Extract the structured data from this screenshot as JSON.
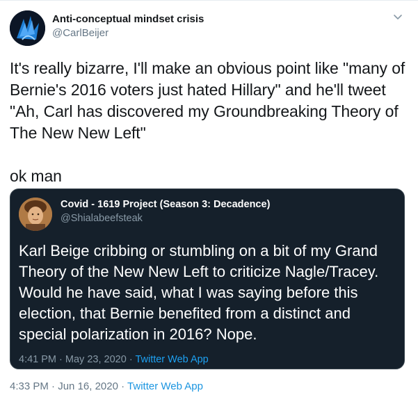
{
  "author": {
    "display_name": "Anti-conceptual mindset crisis",
    "handle": "@CarlBeijer"
  },
  "tweet": {
    "text": "It's really bizarre, I'll make an obvious point like \"many of Bernie's 2016 voters just hated Hillary\" and he'll tweet \"Ah, Carl has discovered my Groundbreaking Theory of The New New Left\"\n\nok man",
    "time": "4:33 PM",
    "separator": "·",
    "date": "Jun 16, 2020",
    "source": "Twitter Web App"
  },
  "quoted_tweet": {
    "display_name": "Covid - 1619 Project (Season 3: Decadence)",
    "handle": "@Shialabeefsteak",
    "text": "Karl Beige cribbing or stumbling on a bit of my Grand Theory of the New New Left to criticize Nagle/Tracey. Would he have said, what I was saying before this election, that Bernie benefited from a distinct and special polarization in 2016? Nope.",
    "time": "4:41 PM",
    "separator": "·",
    "date": "May 23, 2020",
    "source": "Twitter Web App"
  },
  "colors": {
    "link": "#1b95e0",
    "quote_background": "#15202b",
    "secondary_text": "#657786"
  },
  "icons": {
    "menu": "chevron-down-icon"
  }
}
